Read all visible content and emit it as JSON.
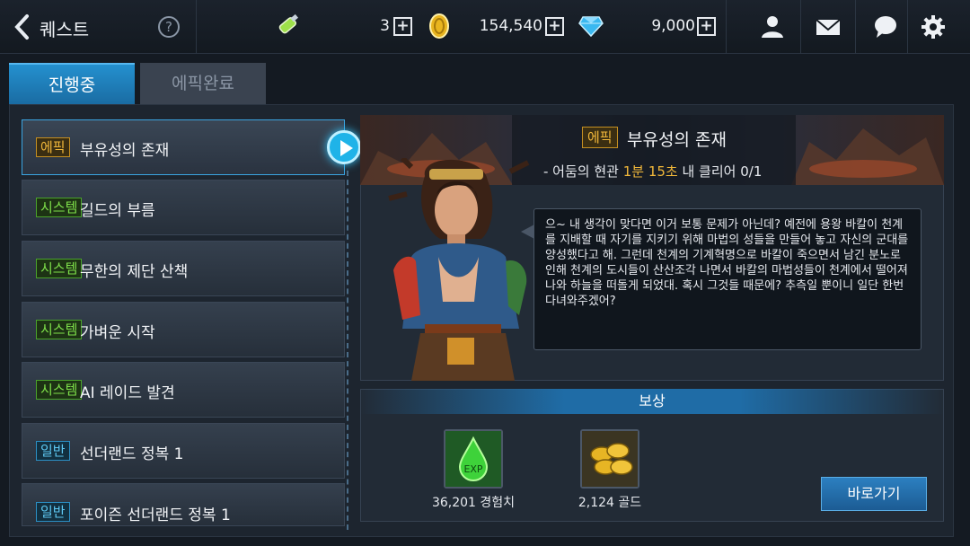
{
  "header": {
    "title": "퀘스트",
    "help": "?",
    "stamina_value": "3",
    "gold_value": "154,540",
    "gem_value": "9,000"
  },
  "tabs": [
    {
      "label": "진행중"
    },
    {
      "label": "에픽완료"
    }
  ],
  "quests": [
    {
      "tag": "에픽",
      "name": "부유성의 존재"
    },
    {
      "tag": "시스템",
      "name": "길드의 부름"
    },
    {
      "tag": "시스템",
      "name": "무한의 제단 산책"
    },
    {
      "tag": "시스템",
      "name": "가벼운 시작"
    },
    {
      "tag": "시스템",
      "name": "AI 레이드 발견"
    },
    {
      "tag": "일반",
      "name": "선더랜드 정복 1"
    },
    {
      "tag": "일반",
      "name": "포이즌 선더랜드 정복 1"
    }
  ],
  "detail": {
    "tag": "에픽",
    "title": "부유성의 존재",
    "sub_prefix": "- 어둠의 현관 ",
    "sub_time": "1분 15초",
    "sub_suffix": " 내 클리어 0/1",
    "dialogue": "으~ 내 생각이 맞다면 이거 보통 문제가 아닌데? 예전에 용왕 바칼이 천계를 지배할 때 자기를 지키기 위해 마법의 성들을 만들어 놓고 자신의 군대를 양성했다고 해. 그런데 천계의 기계혁명으로 바칼이 죽으면서 남긴 분노로 인해 천계의 도시들이 산산조각 나면서 바칼의 마법성들이 천계에서 떨어져 나와 하늘을 떠돌게 되었대. 혹시 그것들 때문에? 추측일 뿐이니 일단 한번 다녀와주겠어?"
  },
  "reward": {
    "heading": "보상",
    "items": [
      {
        "label": "36,201 경험치",
        "icon": "exp-potion-icon"
      },
      {
        "label": "2,124 골드",
        "icon": "gold-coins-icon"
      }
    ],
    "goto_label": "바로가기"
  },
  "colors": {
    "epic": "#f0b73a",
    "system": "#7ee04a",
    "normal": "#5ec8f2",
    "accent": "#1f8fd0"
  }
}
